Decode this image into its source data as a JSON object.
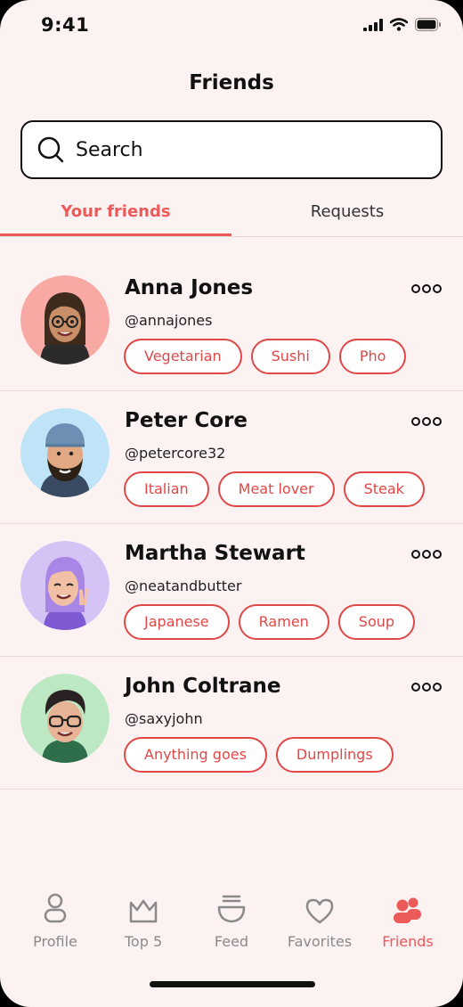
{
  "status_bar": {
    "time": "9:41"
  },
  "header": {
    "title": "Friends"
  },
  "search": {
    "placeholder": "Search"
  },
  "tabs": [
    {
      "label": "Your friends",
      "active": true
    },
    {
      "label": "Requests",
      "active": false
    }
  ],
  "friends": [
    {
      "name": "Anna Jones",
      "handle": "@annajones",
      "tags": [
        "Vegetarian",
        "Sushi",
        "Pho"
      ],
      "avatar_bg": "#f8a9a4"
    },
    {
      "name": "Peter Core",
      "handle": "@petercore32",
      "tags": [
        "Italian",
        "Meat lover",
        "Steak"
      ],
      "avatar_bg": "#bfe3f7"
    },
    {
      "name": "Martha Stewart",
      "handle": "@neatandbutter",
      "tags": [
        "Japanese",
        "Ramen",
        "Soup"
      ],
      "avatar_bg": "#d4c3f4"
    },
    {
      "name": "John Coltrane",
      "handle": "@saxyjohn",
      "tags": [
        "Anything goes",
        "Dumplings"
      ],
      "avatar_bg": "#bde8c4"
    }
  ],
  "nav": [
    {
      "label": "Profile",
      "icon": "profile-icon"
    },
    {
      "label": "Top 5",
      "icon": "crown-icon"
    },
    {
      "label": "Feed",
      "icon": "bowl-icon"
    },
    {
      "label": "Favorites",
      "icon": "heart-icon"
    },
    {
      "label": "Friends",
      "icon": "friends-icon",
      "active": true
    }
  ],
  "colors": {
    "accent": "#ec5a5a",
    "background": "#fdf2f2",
    "tag": "#e04848"
  }
}
